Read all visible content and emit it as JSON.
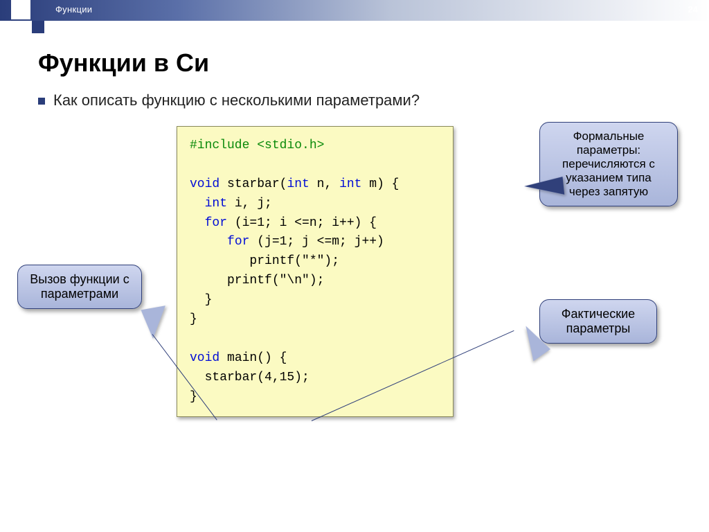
{
  "header": {
    "breadcrumb": "Функции",
    "page_number": "24"
  },
  "title": "Функции в Си",
  "bullet": "Как описать функцию с несколькими параметрами?",
  "code": {
    "l1a": "#include ",
    "l1b": "<stdio.h>",
    "l2": "",
    "l3a": "void",
    "l3b": " starbar(",
    "l3c": "int",
    "l3d": " n, ",
    "l3e": "int",
    "l3f": " m) {",
    "l4a": "  ",
    "l4b": "int",
    "l4c": " i, j;",
    "l5a": "  ",
    "l5b": "for",
    "l5c": " (i=1; i <=n; i++) {",
    "l6a": "     ",
    "l6b": "for",
    "l6c": " (j=1; j <=m; j++)",
    "l7": "        printf(\"*\");",
    "l8": "     printf(\"\\n\");",
    "l9": "  }",
    "l10": "}",
    "l11": "",
    "l12a": "void",
    "l12b": " main() {",
    "l13": "  starbar(4,15);",
    "l14": "}"
  },
  "callouts": {
    "formal": "Формальные параметры: перечисляются с указанием типа через запятую",
    "actual": "Фактические параметры",
    "call": "Вызов функции с параметрами"
  }
}
